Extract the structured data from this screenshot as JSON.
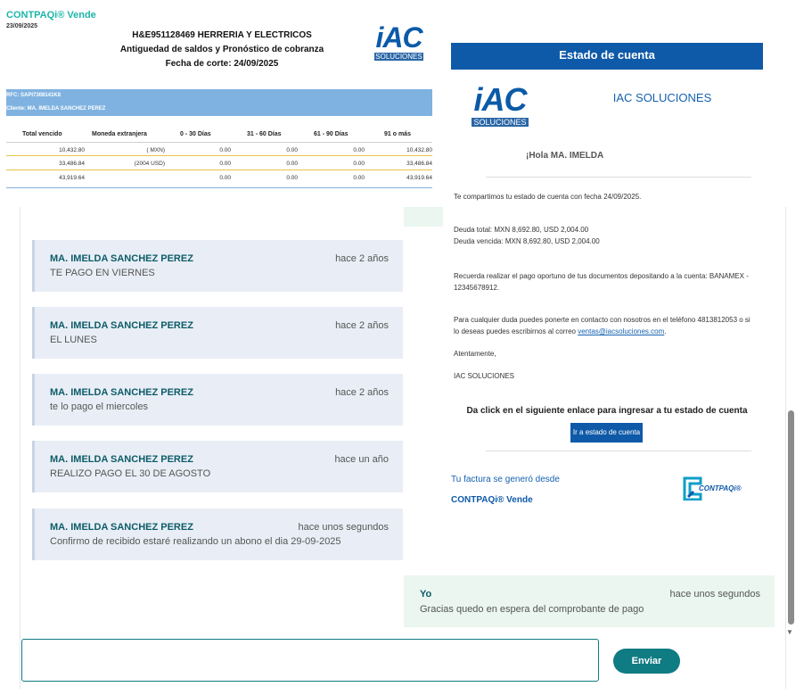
{
  "report": {
    "brand": "CONTPAQi® Vende",
    "date": "23/09/2025",
    "title_lines": [
      "H&E951128469 HERRERIA Y ELECTRICOS",
      "Antiguedad de saldos y Pronóstico de cobranza",
      "Fecha de corte: 24/09/2025"
    ],
    "rfc": "RFC: SAPI7308141K8",
    "cliente": "Cliente: MA. IMELDA SANCHEZ PEREZ",
    "columns": [
      "Total vencido",
      "Moneda extranjera",
      "0 - 30 Días",
      "31 - 60 Días",
      "61 - 90 Días",
      "91 o más"
    ],
    "rows": [
      [
        "10,432.80",
        "( MXN)",
        "0.00",
        "0.00",
        "0.00",
        "10,432.80"
      ],
      [
        "33,486.84",
        "(2004 USD)",
        "0.00",
        "0.00",
        "0.00",
        "33,486.84"
      ],
      [
        "43,919.64",
        "",
        "0.00",
        "0.00",
        "0.00",
        "43,919.64"
      ]
    ],
    "logo": {
      "main": "iAC",
      "sub": "SOLUCIONES"
    }
  },
  "email": {
    "header": "Estado de cuenta",
    "logo": {
      "main": "iAC",
      "sub": "SOLUCIONES"
    },
    "company": "IAC SOLUCIONES",
    "greeting": "¡Hola MA. IMELDA",
    "intro": "Te compartimos tu estado de cuenta con fecha 24/09/2025.",
    "deuda_total": "Deuda total: MXN 8,692.80, USD 2,004.00",
    "deuda_vencida": "Deuda vencida: MXN 8,692.80, USD 2,004.00",
    "recordatorio": "Recuerda realizar el pago oportuno de tus documentos depositando a la cuenta: BANAMEX - 12345678912.",
    "contacto": "Para cualquier duda puedes ponerte en contacto con nosotros en el teléfono 4813812053 o si lo deseas puedes escribirnos al correo",
    "correo": "ventas@iacsoluciones.com",
    "contacto_end": ".",
    "despedida": "Atentamente,",
    "firma": "IAC SOLUCIONES",
    "cta": "Da click en el siguiente enlace para ingresar a tu estado de cuenta",
    "cta_button": "Ir a estado de cuenta",
    "footer_line": "Tu factura se generó desde",
    "footer_brand": "CONTPAQi® Vende",
    "contpaqi_logo": "CONTPAQi®"
  },
  "chat": {
    "messages": [
      {
        "author": "MA. IMELDA SANCHEZ PEREZ",
        "time": "hace 2 años",
        "text": "TE PAGO EN VIERNES"
      },
      {
        "author": "MA. IMELDA SANCHEZ PEREZ",
        "time": "hace 2 años",
        "text": "EL LUNES"
      },
      {
        "author": "MA. IMELDA SANCHEZ PEREZ",
        "time": "hace 2 años",
        "text": "te lo pago el miercoles"
      },
      {
        "author": "MA. IMELDA SANCHEZ PEREZ",
        "time": "hace un año",
        "text": "REALIZO PAGO EL 30 DE AGOSTO"
      },
      {
        "author": "MA. IMELDA SANCHEZ PEREZ",
        "time": "hace unos segundos",
        "text": "Confirmo de recibido estaré realizando un abono el dia 29-09-2025"
      }
    ],
    "own_message": {
      "author": "Yo",
      "time": "hace unos segundos",
      "text": "Gracias quedo en espera del comprobante de pago"
    },
    "input_placeholder": "",
    "send_label": "Enviar"
  },
  "colors": {
    "accent_teal": "#0f7b83",
    "email_blue": "#0f5aa8",
    "band_blue": "#7fb2e0"
  }
}
